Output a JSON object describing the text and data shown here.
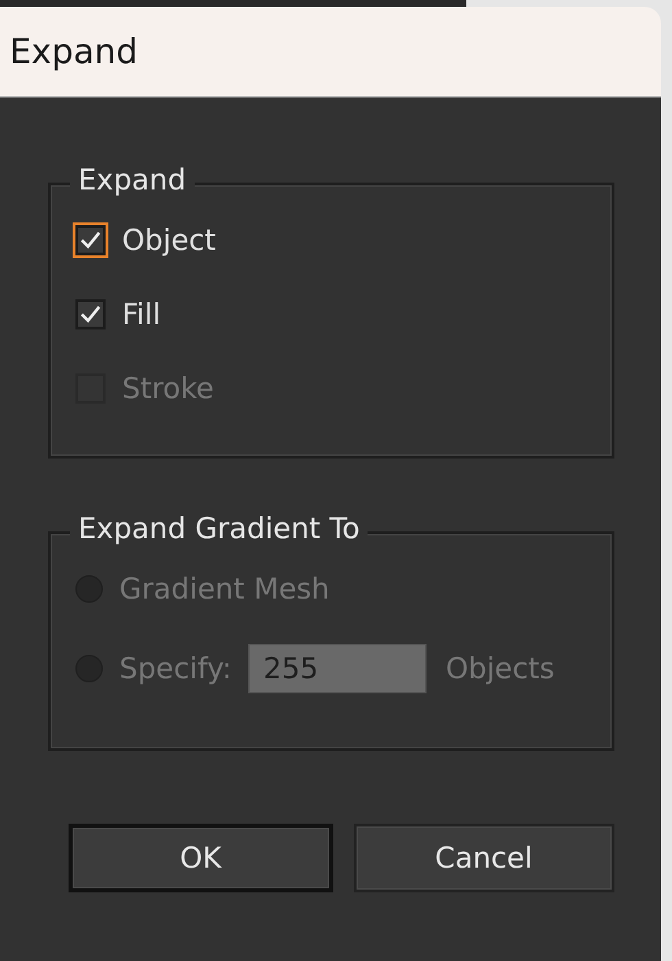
{
  "window": {
    "title": "Expand"
  },
  "expand_group": {
    "title": "Expand",
    "options": [
      {
        "label": "Object",
        "checked": true,
        "focused": true,
        "disabled": false
      },
      {
        "label": "Fill",
        "checked": true,
        "focused": false,
        "disabled": false
      },
      {
        "label": "Stroke",
        "checked": false,
        "focused": false,
        "disabled": true
      }
    ]
  },
  "gradient_group": {
    "title": "Expand Gradient To",
    "options": [
      {
        "kind": "radio",
        "label": "Gradient Mesh",
        "selected": false,
        "disabled": true
      },
      {
        "kind": "radio-field",
        "label": "Specify:",
        "selected": false,
        "disabled": true,
        "value": "255",
        "unit": "Objects"
      }
    ]
  },
  "buttons": [
    {
      "label": "OK",
      "default": true
    },
    {
      "label": "Cancel",
      "default": false
    }
  ]
}
